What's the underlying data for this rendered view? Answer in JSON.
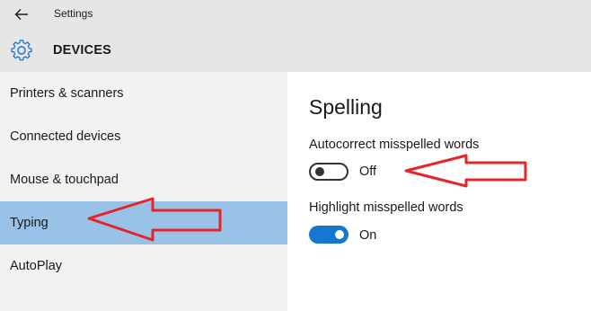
{
  "header": {
    "app_title": "Settings",
    "section": "DEVICES",
    "back_icon": "back-arrow-icon",
    "section_icon": "gear-icon"
  },
  "sidebar": {
    "items": [
      {
        "label": "Printers & scanners",
        "selected": false
      },
      {
        "label": "Connected devices",
        "selected": false
      },
      {
        "label": "Mouse & touchpad",
        "selected": false
      },
      {
        "label": "Typing",
        "selected": true
      },
      {
        "label": "AutoPlay",
        "selected": false
      }
    ]
  },
  "content": {
    "heading": "Spelling",
    "settings": [
      {
        "label": "Autocorrect misspelled words",
        "state": "Off",
        "on": false
      },
      {
        "label": "Highlight misspelled words",
        "state": "On",
        "on": true
      }
    ]
  },
  "colors": {
    "accent": "#1478d2",
    "selected_bg": "#98c2e6",
    "annotation_arrow": "#e8242a"
  }
}
